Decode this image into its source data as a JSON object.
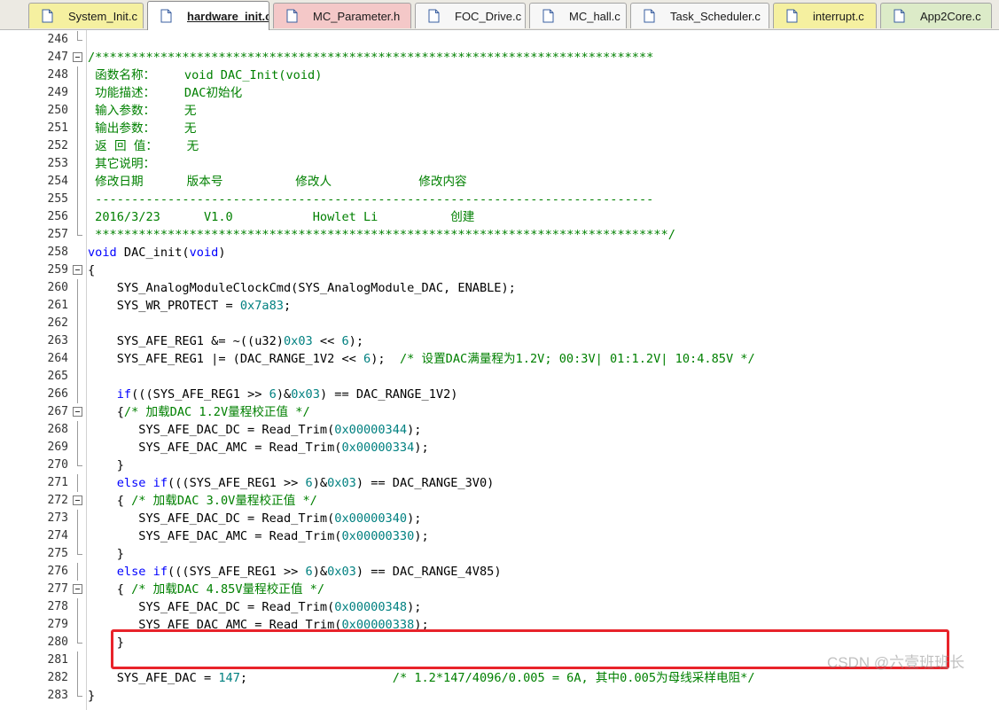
{
  "tabs": [
    {
      "label": "System_Init.c",
      "color": "#f5f0a0",
      "active": false
    },
    {
      "label": "hardware_init.c",
      "color": "#ffffff",
      "active": true
    },
    {
      "label": "MC_Parameter.h",
      "color": "#f4c8c8",
      "active": false
    },
    {
      "label": "FOC_Drive.c",
      "color": "#f7f7f7",
      "active": false
    },
    {
      "label": "MC_hall.c",
      "color": "#f7f7f7",
      "active": false
    },
    {
      "label": "Task_Scheduler.c",
      "color": "#f7f7f7",
      "active": false
    },
    {
      "label": "interrupt.c",
      "color": "#f5f0a0",
      "active": false
    },
    {
      "label": "App2Core.c",
      "color": "#dcebc8",
      "active": false
    }
  ],
  "lines": [
    {
      "num": "246",
      "fold": "end",
      "segs": [
        {
          "t": "",
          "k": "plain"
        }
      ]
    },
    {
      "num": "247",
      "fold": "box",
      "segs": [
        {
          "t": "/*****************************************************************************",
          "k": "comment"
        }
      ]
    },
    {
      "num": "248",
      "fold": "line",
      "segs": [
        {
          "t": " 函数名称：    void DAC_Init(void)",
          "k": "comment"
        }
      ]
    },
    {
      "num": "249",
      "fold": "line",
      "segs": [
        {
          "t": " 功能描述：    DAC初始化",
          "k": "comment"
        }
      ]
    },
    {
      "num": "250",
      "fold": "line",
      "segs": [
        {
          "t": " 输入参数：    无",
          "k": "comment"
        }
      ]
    },
    {
      "num": "251",
      "fold": "line",
      "segs": [
        {
          "t": " 输出参数：    无",
          "k": "comment"
        }
      ]
    },
    {
      "num": "252",
      "fold": "line",
      "segs": [
        {
          "t": " 返 回 值：    无",
          "k": "comment"
        }
      ]
    },
    {
      "num": "253",
      "fold": "line",
      "segs": [
        {
          "t": " 其它说明：",
          "k": "comment"
        }
      ]
    },
    {
      "num": "254",
      "fold": "line",
      "segs": [
        {
          "t": " 修改日期      版本号          修改人            修改内容",
          "k": "comment"
        }
      ]
    },
    {
      "num": "255",
      "fold": "line",
      "segs": [
        {
          "t": " -----------------------------------------------------------------------------",
          "k": "comment"
        }
      ]
    },
    {
      "num": "256",
      "fold": "line",
      "segs": [
        {
          "t": " 2016/3/23      V1.0           Howlet Li          创建",
          "k": "comment"
        }
      ]
    },
    {
      "num": "257",
      "fold": "end",
      "segs": [
        {
          "t": " *******************************************************************************/",
          "k": "comment"
        }
      ]
    },
    {
      "num": "258",
      "fold": "",
      "segs": [
        {
          "t": "void",
          "k": "keyword"
        },
        {
          "t": " DAC_init(",
          "k": "plain"
        },
        {
          "t": "void",
          "k": "keyword"
        },
        {
          "t": ")",
          "k": "plain"
        }
      ]
    },
    {
      "num": "259",
      "fold": "box",
      "segs": [
        {
          "t": "{",
          "k": "plain"
        }
      ]
    },
    {
      "num": "260",
      "fold": "line",
      "segs": [
        {
          "t": "    SYS_AnalogModuleClockCmd(SYS_AnalogModule_DAC, ENABLE);",
          "k": "plain"
        }
      ]
    },
    {
      "num": "261",
      "fold": "line",
      "segs": [
        {
          "t": "    SYS_WR_PROTECT = ",
          "k": "plain"
        },
        {
          "t": "0x7a83",
          "k": "number"
        },
        {
          "t": ";",
          "k": "plain"
        }
      ]
    },
    {
      "num": "262",
      "fold": "line",
      "segs": [
        {
          "t": "",
          "k": "plain"
        }
      ]
    },
    {
      "num": "263",
      "fold": "line",
      "segs": [
        {
          "t": "    SYS_AFE_REG1 &= ~((u32)",
          "k": "plain"
        },
        {
          "t": "0x03",
          "k": "number"
        },
        {
          "t": " << ",
          "k": "plain"
        },
        {
          "t": "6",
          "k": "number"
        },
        {
          "t": ");",
          "k": "plain"
        }
      ]
    },
    {
      "num": "264",
      "fold": "line",
      "segs": [
        {
          "t": "    SYS_AFE_REG1 |= (DAC_RANGE_1V2 << ",
          "k": "plain"
        },
        {
          "t": "6",
          "k": "number"
        },
        {
          "t": ");  ",
          "k": "plain"
        },
        {
          "t": "/* 设置DAC满量程为1.2V; 00:3V| 01:1.2V| 10:4.85V */",
          "k": "comment"
        }
      ]
    },
    {
      "num": "265",
      "fold": "line",
      "segs": [
        {
          "t": "",
          "k": "plain"
        }
      ]
    },
    {
      "num": "266",
      "fold": "line",
      "segs": [
        {
          "t": "    ",
          "k": "plain"
        },
        {
          "t": "if",
          "k": "keyword"
        },
        {
          "t": "(((SYS_AFE_REG1 >> ",
          "k": "plain"
        },
        {
          "t": "6",
          "k": "number"
        },
        {
          "t": ")&",
          "k": "plain"
        },
        {
          "t": "0x03",
          "k": "number"
        },
        {
          "t": ") == DAC_RANGE_1V2)",
          "k": "plain"
        }
      ]
    },
    {
      "num": "267",
      "fold": "box",
      "segs": [
        {
          "t": "    {",
          "k": "plain"
        },
        {
          "t": "/* 加载DAC 1.2V量程校正值 */",
          "k": "comment"
        }
      ]
    },
    {
      "num": "268",
      "fold": "line",
      "segs": [
        {
          "t": "       SYS_AFE_DAC_DC = Read_Trim(",
          "k": "plain"
        },
        {
          "t": "0x00000344",
          "k": "number"
        },
        {
          "t": ");",
          "k": "plain"
        }
      ]
    },
    {
      "num": "269",
      "fold": "line",
      "segs": [
        {
          "t": "       SYS_AFE_DAC_AMC = Read_Trim(",
          "k": "plain"
        },
        {
          "t": "0x00000334",
          "k": "number"
        },
        {
          "t": ");",
          "k": "plain"
        }
      ]
    },
    {
      "num": "270",
      "fold": "end",
      "segs": [
        {
          "t": "    }",
          "k": "plain"
        }
      ]
    },
    {
      "num": "271",
      "fold": "line",
      "segs": [
        {
          "t": "    ",
          "k": "plain"
        },
        {
          "t": "else if",
          "k": "keyword"
        },
        {
          "t": "(((SYS_AFE_REG1 >> ",
          "k": "plain"
        },
        {
          "t": "6",
          "k": "number"
        },
        {
          "t": ")&",
          "k": "plain"
        },
        {
          "t": "0x03",
          "k": "number"
        },
        {
          "t": ") == DAC_RANGE_3V0)",
          "k": "plain"
        }
      ]
    },
    {
      "num": "272",
      "fold": "box",
      "segs": [
        {
          "t": "    { ",
          "k": "plain"
        },
        {
          "t": "/* 加载DAC 3.0V量程校正值 */",
          "k": "comment"
        }
      ]
    },
    {
      "num": "273",
      "fold": "line",
      "segs": [
        {
          "t": "       SYS_AFE_DAC_DC = Read_Trim(",
          "k": "plain"
        },
        {
          "t": "0x00000340",
          "k": "number"
        },
        {
          "t": ");",
          "k": "plain"
        }
      ]
    },
    {
      "num": "274",
      "fold": "line",
      "segs": [
        {
          "t": "       SYS_AFE_DAC_AMC = Read_Trim(",
          "k": "plain"
        },
        {
          "t": "0x00000330",
          "k": "number"
        },
        {
          "t": ");",
          "k": "plain"
        }
      ]
    },
    {
      "num": "275",
      "fold": "end",
      "segs": [
        {
          "t": "    }",
          "k": "plain"
        }
      ]
    },
    {
      "num": "276",
      "fold": "line",
      "segs": [
        {
          "t": "    ",
          "k": "plain"
        },
        {
          "t": "else if",
          "k": "keyword"
        },
        {
          "t": "(((SYS_AFE_REG1 >> ",
          "k": "plain"
        },
        {
          "t": "6",
          "k": "number"
        },
        {
          "t": ")&",
          "k": "plain"
        },
        {
          "t": "0x03",
          "k": "number"
        },
        {
          "t": ") == DAC_RANGE_4V85)",
          "k": "plain"
        }
      ]
    },
    {
      "num": "277",
      "fold": "box",
      "segs": [
        {
          "t": "    { ",
          "k": "plain"
        },
        {
          "t": "/* 加载DAC 4.85V量程校正值 */",
          "k": "comment"
        }
      ]
    },
    {
      "num": "278",
      "fold": "line",
      "segs": [
        {
          "t": "       SYS_AFE_DAC_DC = Read_Trim(",
          "k": "plain"
        },
        {
          "t": "0x00000348",
          "k": "number"
        },
        {
          "t": ");",
          "k": "plain"
        }
      ]
    },
    {
      "num": "279",
      "fold": "line",
      "segs": [
        {
          "t": "       SYS_AFE_DAC_AMC = Read_Trim(",
          "k": "plain"
        },
        {
          "t": "0x00000338",
          "k": "number"
        },
        {
          "t": ");",
          "k": "plain"
        }
      ]
    },
    {
      "num": "280",
      "fold": "end",
      "segs": [
        {
          "t": "    }",
          "k": "plain"
        }
      ]
    },
    {
      "num": "281",
      "fold": "line",
      "segs": [
        {
          "t": "",
          "k": "plain"
        }
      ]
    },
    {
      "num": "282",
      "fold": "line",
      "segs": [
        {
          "t": "    SYS_AFE_DAC = ",
          "k": "plain"
        },
        {
          "t": "147",
          "k": "number"
        },
        {
          "t": ";                    ",
          "k": "plain"
        },
        {
          "t": "/* 1.2*147/4096/0.005 = 6A, 其中0.005为母线采样电阻*/",
          "k": "comment"
        }
      ]
    },
    {
      "num": "283",
      "fold": "end",
      "segs": [
        {
          "t": "}",
          "k": "plain"
        }
      ]
    }
  ],
  "watermark": "CSDN @六壹班班长",
  "colors": {
    "comment": "#008000",
    "keyword": "#0000ff",
    "number": "#008080",
    "highlight": "#e8232a"
  }
}
